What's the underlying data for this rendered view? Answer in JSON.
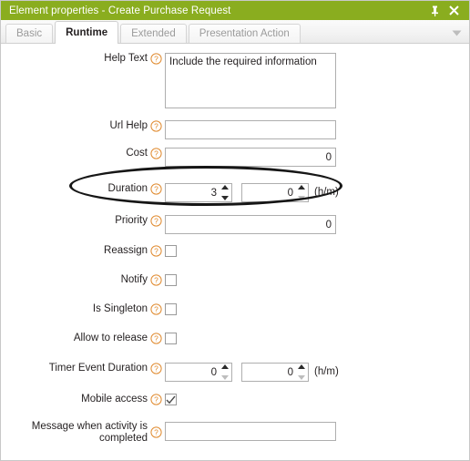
{
  "window": {
    "title": "Element properties - Create Purchase Request",
    "pin_icon": "pin-icon",
    "close_icon": "close-icon",
    "accent_color": "#8aad1f",
    "help_icon_color": "#e08a2e"
  },
  "tabs": {
    "items": [
      {
        "label": "Basic",
        "active": false
      },
      {
        "label": "Runtime",
        "active": true
      },
      {
        "label": "Extended",
        "active": false
      },
      {
        "label": "Presentation Action",
        "active": false
      }
    ],
    "overflow_icon": "chevron-down-icon"
  },
  "form": {
    "help_glyph": "?",
    "fields": {
      "help_text": {
        "label": "Help Text",
        "value": "Include the required information",
        "placeholder": ""
      },
      "url_help": {
        "label": "Url Help",
        "value": "",
        "placeholder": ""
      },
      "cost": {
        "label": "Cost",
        "value": "0",
        "placeholder": ""
      },
      "duration": {
        "label": "Duration",
        "hours": "3",
        "minutes": "0",
        "unit": "(h/m)",
        "highlighted": true
      },
      "priority": {
        "label": "Priority",
        "value": "0",
        "placeholder": ""
      },
      "reassign": {
        "label": "Reassign",
        "checked": false
      },
      "notify": {
        "label": "Notify",
        "checked": false
      },
      "is_singleton": {
        "label": "Is Singleton",
        "checked": false
      },
      "allow_to_release": {
        "label": "Allow to release",
        "checked": false
      },
      "timer_event_duration": {
        "label": "Timer Event Duration",
        "hours": "0",
        "minutes": "0",
        "unit": "(h/m)"
      },
      "mobile_access": {
        "label": "Mobile access",
        "checked": true
      },
      "message_completed": {
        "label": "Message when activity is\ncompleted",
        "value": "",
        "placeholder": ""
      }
    }
  }
}
